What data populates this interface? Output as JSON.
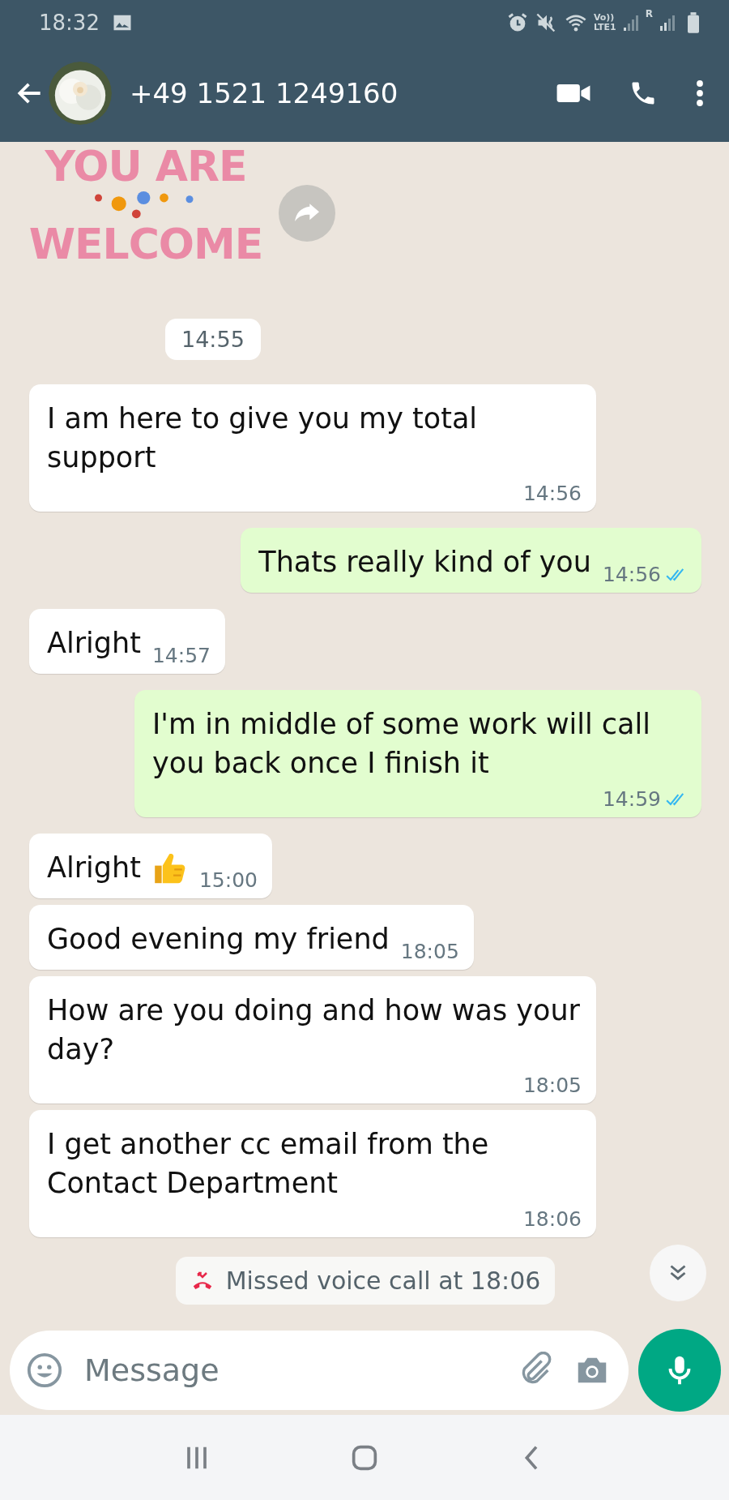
{
  "status_bar": {
    "time": "18:32",
    "volte": "Vo))",
    "lte": "LTE1",
    "roaming": "R"
  },
  "header": {
    "contact": "+49 1521 1249160"
  },
  "sticker": {
    "lines": [
      "YOU ARE",
      "WELCOME"
    ]
  },
  "date_chip": "14:55",
  "messages": [
    {
      "kind": "in",
      "text": "I am here to give you my total support",
      "time": "14:56"
    },
    {
      "kind": "out",
      "text": "Thats really kind of you",
      "time": "14:56",
      "read": true
    },
    {
      "kind": "in",
      "text": "Alright",
      "time": "14:57"
    },
    {
      "kind": "out",
      "text": "I'm in middle of some work will call you back once I finish it",
      "time": "14:59",
      "read": true
    },
    {
      "kind": "in",
      "text": "Alright",
      "thumbs_up": true,
      "time": "15:00"
    },
    {
      "kind": "in",
      "text": "Good evening my friend",
      "time": "18:05"
    },
    {
      "kind": "in",
      "text": "How are you doing and how was your day?",
      "time": "18:05"
    },
    {
      "kind": "in",
      "text": "I get another cc email from the Contact Department",
      "time": "18:06"
    }
  ],
  "system_message": "Missed voice call at 18:06",
  "composer": {
    "placeholder": "Message"
  }
}
